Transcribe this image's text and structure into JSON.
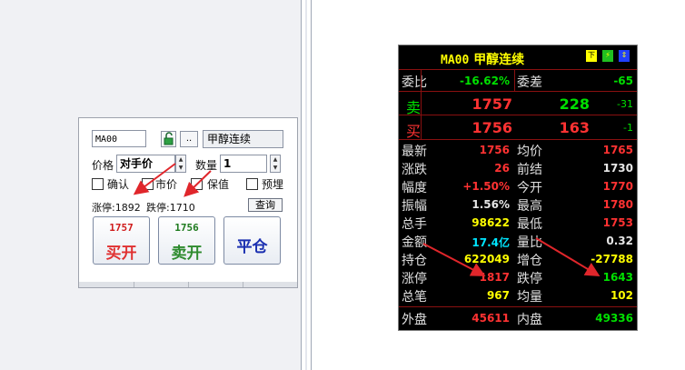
{
  "order_panel": {
    "code": "MA00",
    "name": "甲醇连续",
    "more_label": "..",
    "price_label": "价格",
    "price_value": "对手价",
    "qty_label": "数量",
    "qty_value": "1",
    "checkboxes": [
      "确认",
      "市价",
      "保值",
      "预埋"
    ],
    "limit_up": "涨停:1892",
    "limit_down": "跌停:1710",
    "query_label": "查询",
    "buy": {
      "price": "1757",
      "label": "买开"
    },
    "sell": {
      "price": "1756",
      "label": "卖开"
    },
    "close": {
      "label": "平仓"
    }
  },
  "quote": {
    "code": "MA00",
    "name": "甲醇连续",
    "buttons": [
      "下",
      "⚡",
      "⇕"
    ],
    "weibi_label": "委比",
    "weibi_value": "-16.62%",
    "weicha_label": "委差",
    "weicha_value": "-65",
    "ask": {
      "label": "卖",
      "price": "1757",
      "volume": "228",
      "change": "-31"
    },
    "bid": {
      "label": "买",
      "price": "1756",
      "volume": "163",
      "change": "-1"
    },
    "rows": [
      {
        "l1": "最新",
        "v1": "1756",
        "c1": "red",
        "l2": "均价",
        "v2": "1765",
        "c2": "red"
      },
      {
        "l1": "涨跌",
        "v1": "26",
        "c1": "red",
        "l2": "前结",
        "v2": "1730",
        "c2": "white"
      },
      {
        "l1": "幅度",
        "v1": "+1.50%",
        "c1": "red",
        "l2": "今开",
        "v2": "1770",
        "c2": "red"
      },
      {
        "l1": "振幅",
        "v1": "1.56%",
        "c1": "white",
        "l2": "最高",
        "v2": "1780",
        "c2": "red"
      },
      {
        "l1": "总手",
        "v1": "98622",
        "c1": "yellow",
        "l2": "最低",
        "v2": "1753",
        "c2": "red"
      },
      {
        "l1": "金额",
        "v1": "17.4亿",
        "c1": "cyan",
        "l2": "量比",
        "v2": "0.32",
        "c2": "white"
      },
      {
        "l1": "持仓",
        "v1": "622049",
        "c1": "yellow",
        "l2": "增仓",
        "v2": "-27788",
        "c2": "yellow"
      },
      {
        "l1": "涨停",
        "v1": "1817",
        "c1": "red",
        "l2": "跌停",
        "v2": "1643",
        "c2": "green"
      },
      {
        "l1": "总笔",
        "v1": "967",
        "c1": "yellow",
        "l2": "均量",
        "v2": "102",
        "c2": "yellow"
      }
    ],
    "outer_label": "外盘",
    "outer_value": "45611",
    "inner_label": "内盘",
    "inner_value": "49336"
  },
  "colors": {
    "red": "#ff3232",
    "green": "#00e000",
    "yellow": "#ffff00",
    "cyan": "#00e5ff",
    "arrow": "#e0262b"
  }
}
